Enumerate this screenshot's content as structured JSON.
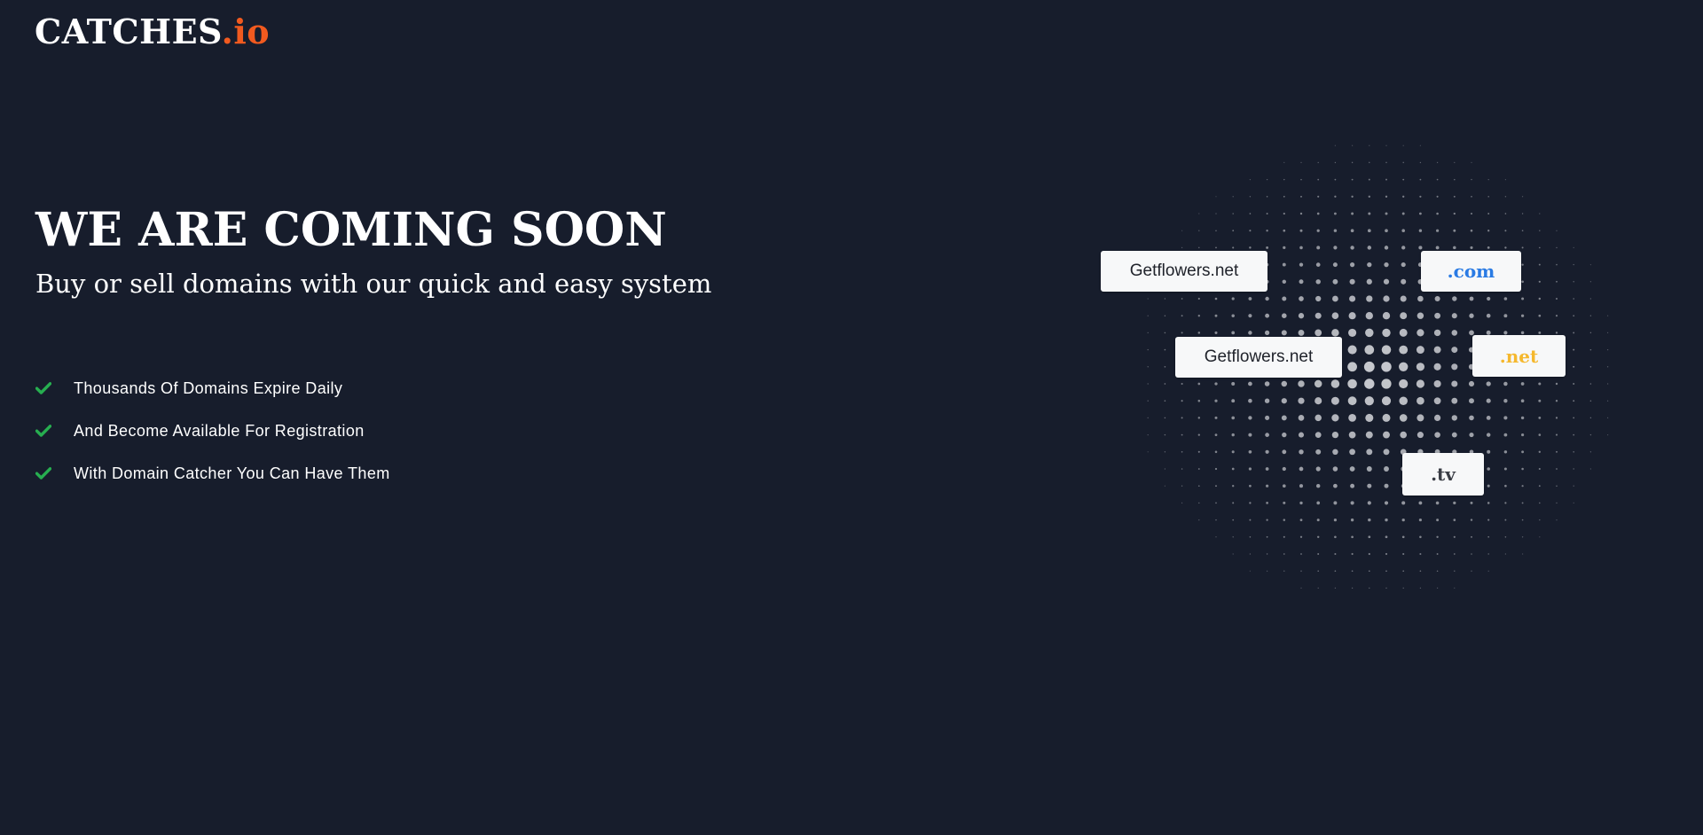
{
  "brand": {
    "name": "CATCHES",
    "tld": ".io",
    "text_color": "#ffffff",
    "accent_color": "#f15a1f"
  },
  "hero": {
    "title": "WE ARE COMING SOON",
    "subtitle": "Buy or sell domains with our quick and easy system"
  },
  "features": [
    {
      "icon": "check-icon",
      "text": "Thousands Of Domains Expire Daily"
    },
    {
      "icon": "check-icon",
      "text": "And Become Available For Registration"
    },
    {
      "icon": "check-icon",
      "text": "With Domain Catcher You Can Have Them"
    }
  ],
  "domain_cards": [
    {
      "label": "Getflowers.net",
      "color": "#20232b"
    },
    {
      "label": ".com",
      "color": "#2a7be4"
    },
    {
      "label": "Getflowers.net",
      "color": "#20232b"
    },
    {
      "label": ".net",
      "color": "#f5b82e"
    },
    {
      "label": ".tv",
      "color": "#3a3d45"
    }
  ],
  "colors": {
    "background": "#171d2c",
    "check": "#27ae50",
    "dots": "#c9cbd0"
  }
}
